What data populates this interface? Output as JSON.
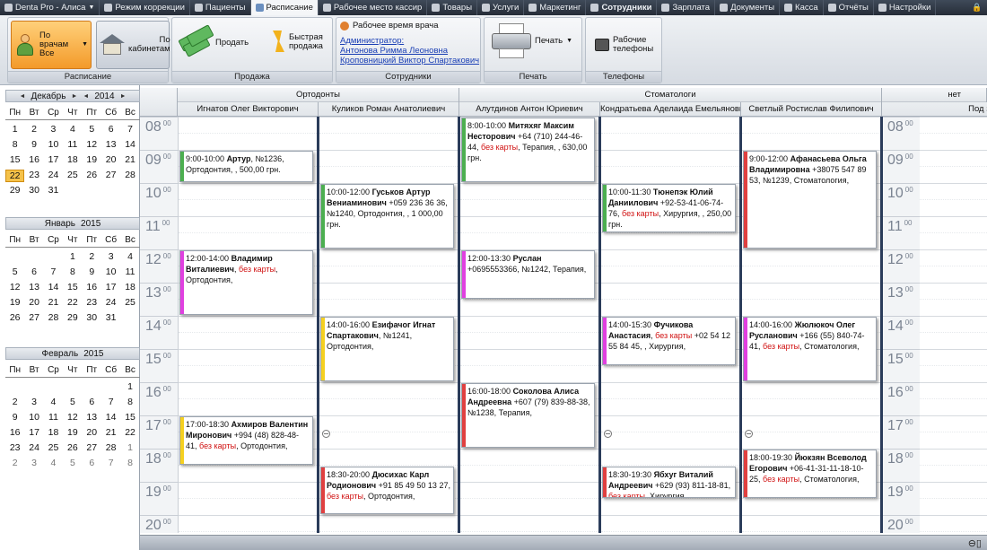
{
  "menu": [
    {
      "label": "Denta Pro - Алиса",
      "icon": "app-logo-icon",
      "arrow": true
    },
    {
      "label": "Режим коррекции",
      "icon": "mode-icon"
    },
    {
      "label": "Пациенты",
      "icon": "patients-icon"
    },
    {
      "label": "Расписание",
      "icon": "schedule-icon",
      "active": true
    },
    {
      "label": "Рабочее место кассир",
      "icon": "cashier-icon"
    },
    {
      "label": "Товары",
      "icon": "goods-icon"
    },
    {
      "label": "Услуги",
      "icon": "services-icon"
    },
    {
      "label": "Маркетинг",
      "icon": "marketing-icon"
    },
    {
      "label": "Сотрудники",
      "icon": "staff-icon",
      "bold": true
    },
    {
      "label": "Зарплата",
      "icon": "salary-icon"
    },
    {
      "label": "Документы",
      "icon": "documents-icon"
    },
    {
      "label": "Касса",
      "icon": "cashbox-icon"
    },
    {
      "label": "Отчёты",
      "icon": "reports-icon"
    },
    {
      "label": "Настройки",
      "icon": "settings-icon"
    }
  ],
  "ribbon": {
    "schedule": {
      "label": "Расписание",
      "by_doctors": "По врачам",
      "by_doctors_value": "Все",
      "by_rooms": "По кабинетам"
    },
    "sale": {
      "label": "Продажа",
      "sell": "Продать",
      "quick_sale": "Быстрая продажа"
    },
    "staff": {
      "label": "Сотрудники",
      "work_time": "Рабочее время врача",
      "admin_label": "Администратор:",
      "admin_name": "Антонова Римма Леоновна",
      "doctor_name": "Кроповницкий Виктор Спартакович"
    },
    "print": {
      "label": "Печать",
      "button": "Печать"
    },
    "phones": {
      "label": "Телефоны",
      "button": "Рабочие телефоны"
    }
  },
  "calendars": [
    {
      "month": "Декабрь",
      "year": "2014",
      "nav": true,
      "dow": [
        "Пн",
        "Вт",
        "Ср",
        "Чт",
        "Пт",
        "Сб",
        "Вс"
      ],
      "weeks": [
        [
          1,
          2,
          3,
          4,
          5,
          6,
          7
        ],
        [
          8,
          9,
          10,
          11,
          12,
          13,
          14
        ],
        [
          15,
          16,
          17,
          18,
          19,
          20,
          21
        ],
        [
          22,
          23,
          24,
          25,
          26,
          27,
          28
        ],
        [
          29,
          30,
          31,
          "",
          "",
          "",
          ""
        ]
      ],
      "today": 22
    },
    {
      "month": "Январь",
      "year": "2015",
      "dow": [
        "Пн",
        "Вт",
        "Ср",
        "Чт",
        "Пт",
        "Сб",
        "Вс"
      ],
      "weeks": [
        [
          "",
          "",
          "",
          1,
          2,
          3,
          4
        ],
        [
          5,
          6,
          7,
          8,
          9,
          10,
          11
        ],
        [
          12,
          13,
          14,
          15,
          16,
          17,
          18
        ],
        [
          19,
          20,
          21,
          22,
          23,
          24,
          25
        ],
        [
          26,
          27,
          28,
          29,
          30,
          31,
          ""
        ]
      ]
    },
    {
      "month": "Февраль",
      "year": "2015",
      "dow": [
        "Пн",
        "Вт",
        "Ср",
        "Чт",
        "Пт",
        "Сб",
        "Вс"
      ],
      "weeks": [
        [
          "",
          "",
          "",
          "",
          "",
          "",
          1
        ],
        [
          2,
          3,
          4,
          5,
          6,
          7,
          8
        ],
        [
          9,
          10,
          11,
          12,
          13,
          14,
          15
        ],
        [
          16,
          17,
          18,
          19,
          20,
          21,
          22
        ],
        [
          23,
          24,
          25,
          26,
          27,
          28,
          1
        ],
        [
          2,
          3,
          4,
          5,
          6,
          7,
          8
        ]
      ],
      "other_last_week": true
    }
  ],
  "groups": [
    "Ортодонты",
    "Стоматологи",
    "нет"
  ],
  "doctors": [
    "Игнатов Олег Викторович",
    "Куликов Роман Анатолиевич",
    "Алутдинов Антон Юриевич",
    "Кондратьева Аделаида Емельяновна",
    "Светлый Ростислав Филипович",
    "Под запись"
  ],
  "hours": [
    "08",
    "09",
    "10",
    "11",
    "12",
    "13",
    "14",
    "15",
    "16",
    "17",
    "18",
    "19",
    "20"
  ],
  "minutes": "00",
  "appointments": [
    {
      "col": 0,
      "start": 9,
      "end": 10,
      "time": "9:00-10:00",
      "name": "Артур",
      "rest": ", №1236,",
      "line2": "Ортодонтия, , 500,00 грн.",
      "color": "#4caf50"
    },
    {
      "col": 0,
      "start": 12,
      "end": 14,
      "time": "12:00-14:00",
      "name": "Владимир Виталиевич",
      "red": "без карты",
      "rest": ",",
      "line2": "Ортодонтия,",
      "color": "#e040e0"
    },
    {
      "col": 0,
      "start": 17,
      "end": 18.5,
      "time": "17:00-18:30",
      "name": "Ахмиров Валентин Миронович",
      "rest": " +994 (48) 828-48-41,",
      "red2": "без карты",
      "line2": ", Ортодонтия,",
      "color": "#f5d020"
    },
    {
      "col": 1,
      "start": 10,
      "end": 12,
      "time": "10:00-12:00",
      "name": "Гуськов Артур Вениаминович",
      "rest": " +059 236 36 36, №1240, Ортодонтия, , 1 000,00 грн.",
      "color": "#4caf50"
    },
    {
      "col": 1,
      "start": 14,
      "end": 16,
      "time": "14:00-16:00",
      "name": "Езифачог Игнат Спартакович",
      "rest": ", №1241,",
      "line2": "Ортодонтия,",
      "color": "#f5d020"
    },
    {
      "col": 1,
      "start": 18.5,
      "end": 20,
      "time": "18:30-20:00",
      "name": "Дюсихас Карл Родионович",
      "rest": " +91 85 49 50 13 27,",
      "red2": "без карты",
      "line2": ", Ортодонтия,",
      "color": "#e04040"
    },
    {
      "col": 2,
      "start": 8,
      "end": 10,
      "time": "8:00-10:00",
      "name": "Митяхяг Максим Несторович",
      "rest": " +64 (710) 244-46-44,",
      "red2": "без карты",
      "line2": ", Терапия, , 630,00 грн.",
      "color": "#4caf50"
    },
    {
      "col": 2,
      "start": 12,
      "end": 13.5,
      "time": "12:00-13:30",
      "name": "Руслан",
      "rest": " +0695553366, №1242, Терапия,",
      "color": "#e040e0"
    },
    {
      "col": 2,
      "start": 16,
      "end": 18,
      "time": "16:00-18:00",
      "name": "Соколова Алиса Андреевна",
      "rest": " +607 (79) 839-88-38, №1238, Терапия,",
      "color": "#e04040"
    },
    {
      "col": 3,
      "start": 10,
      "end": 11.5,
      "time": "10:00-11:30",
      "name": "Тюнепэк Юлий Даниилович",
      "rest": " +92-53-41-06-74-76,",
      "red2": "без карты",
      "line2": ", Хирургия, , 250,00 грн.",
      "color": "#4caf50"
    },
    {
      "col": 3,
      "start": 14,
      "end": 15.5,
      "time": "14:00-15:30",
      "name": "Фучикова Анастасия",
      "rest": " +02 54 12 55 84 45,",
      "red": "без карты",
      "line2": ", Хирургия,",
      "color": "#e040e0"
    },
    {
      "col": 3,
      "start": 18.5,
      "end": 19.5,
      "time": "18:30-19:30",
      "name": "Ябхуг Виталий Андреевич",
      "rest": " +629 (93) 811-18-81,",
      "red2": "без карты",
      "line2": ", Хирургия,",
      "color": "#e04040"
    },
    {
      "col": 4,
      "start": 9,
      "end": 12,
      "time": "9:00-12:00",
      "name": "Афанасьева Ольга Владимировна",
      "rest": " +38075 547 89 53, №1239, Стоматология,",
      "color": "#e04040"
    },
    {
      "col": 4,
      "start": 14,
      "end": 16,
      "time": "14:00-16:00",
      "name": "Жюлюкоч Олег Русланович",
      "rest": " +166 (55) 840-74-41,",
      "red2": "без карты",
      "line2": ", Стоматология,",
      "color": "#e040e0"
    },
    {
      "col": 4,
      "start": 18,
      "end": 19.5,
      "time": "18:00-19:30",
      "name": "Йюкзян Всеволод Егорович",
      "rest": " +06-41-31-11-18-10-25,",
      "red2": "без карты",
      "line2": ", Стоматология,",
      "color": "#e04040"
    }
  ]
}
